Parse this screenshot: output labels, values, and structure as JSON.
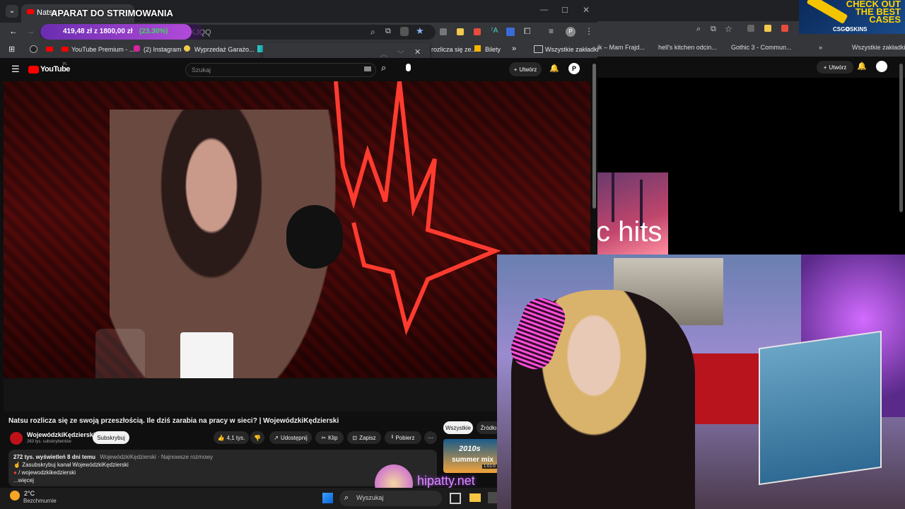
{
  "overlay": {
    "stream_label": "APARAT DO STRIMOWANIA",
    "goal_current": "419,48 zł",
    "goal_target": "z 1800,00 zł",
    "goal_percent_text": "(23.30%)",
    "goal_progress": 0.233,
    "goal_url_fragment": "2oHQKJQQ",
    "watermark": "hipatty.net"
  },
  "browser": {
    "tab_title": "Natsu",
    "bookmarks": [
      "YouTube Premium - ...",
      "(2) Instagram",
      "Wyprzedaż Garażo...",
      "rozlicza się ze...",
      "Bilety",
      "Wszystkie zakładki"
    ],
    "profile_initial": "P"
  },
  "youtube": {
    "logo": "YouTube",
    "logo_region": "PL",
    "search_placeholder": "Szukaj",
    "create_label": "Utwórz",
    "avatar_initial": "P",
    "video_title": "Natsu rozlicza się ze swoją przeszłością. Ile dziś zarabia na pracy w sieci? | WojewódzkiKędzierski",
    "channel_name": "WojewódzkiKędzierski",
    "subscribers": "263 tys. subskrybentów",
    "subscribe_label": "Subskrybuj",
    "likes": "4,1 tys.",
    "share_label": "Udostępnij",
    "clip_label": "Klip",
    "save_label": "Zapisz",
    "download_label": "Pobierz",
    "views_line": "272 tys. wyświetleń  8 dni temu",
    "views_tags": "WojewódzkiKędzierski · Najnowsze rozmowy",
    "desc_line1": "Zasubskrybuj kanał WojewódzkiKędzierski",
    "desc_line2": "/ wojewodzkikedzierski",
    "more_label": "...więcej",
    "filter_all": "Wszystkie",
    "filter_source": "Źródło",
    "rec_thumb_text1": "2010s",
    "rec_thumb_text2": "summer mix",
    "rec_duration": "1:01:0"
  },
  "second_window": {
    "bookmarks": [
      "ik – Mam Frajd...",
      "hell's kitchen odcin...",
      "Gothic 3 - Commun...",
      "Wszystkie zakładki"
    ],
    "create_label": "Utwórz",
    "thumb_text": "c hits",
    "ad_text1": "CHECK OUT",
    "ad_text2": "THE BEST",
    "ad_text3": "CASES",
    "ad_logo": "CSG✪SKINS"
  },
  "taskbar": {
    "temperature": "2°C",
    "weather": "Bezchmurnie",
    "search_label": "Wyszukaj"
  },
  "colors": {
    "accent_purple": "#9b3fd6",
    "goal_green": "#3ddc5a",
    "yt_red": "#ff0000",
    "bg_dark": "#0f0f0f"
  }
}
